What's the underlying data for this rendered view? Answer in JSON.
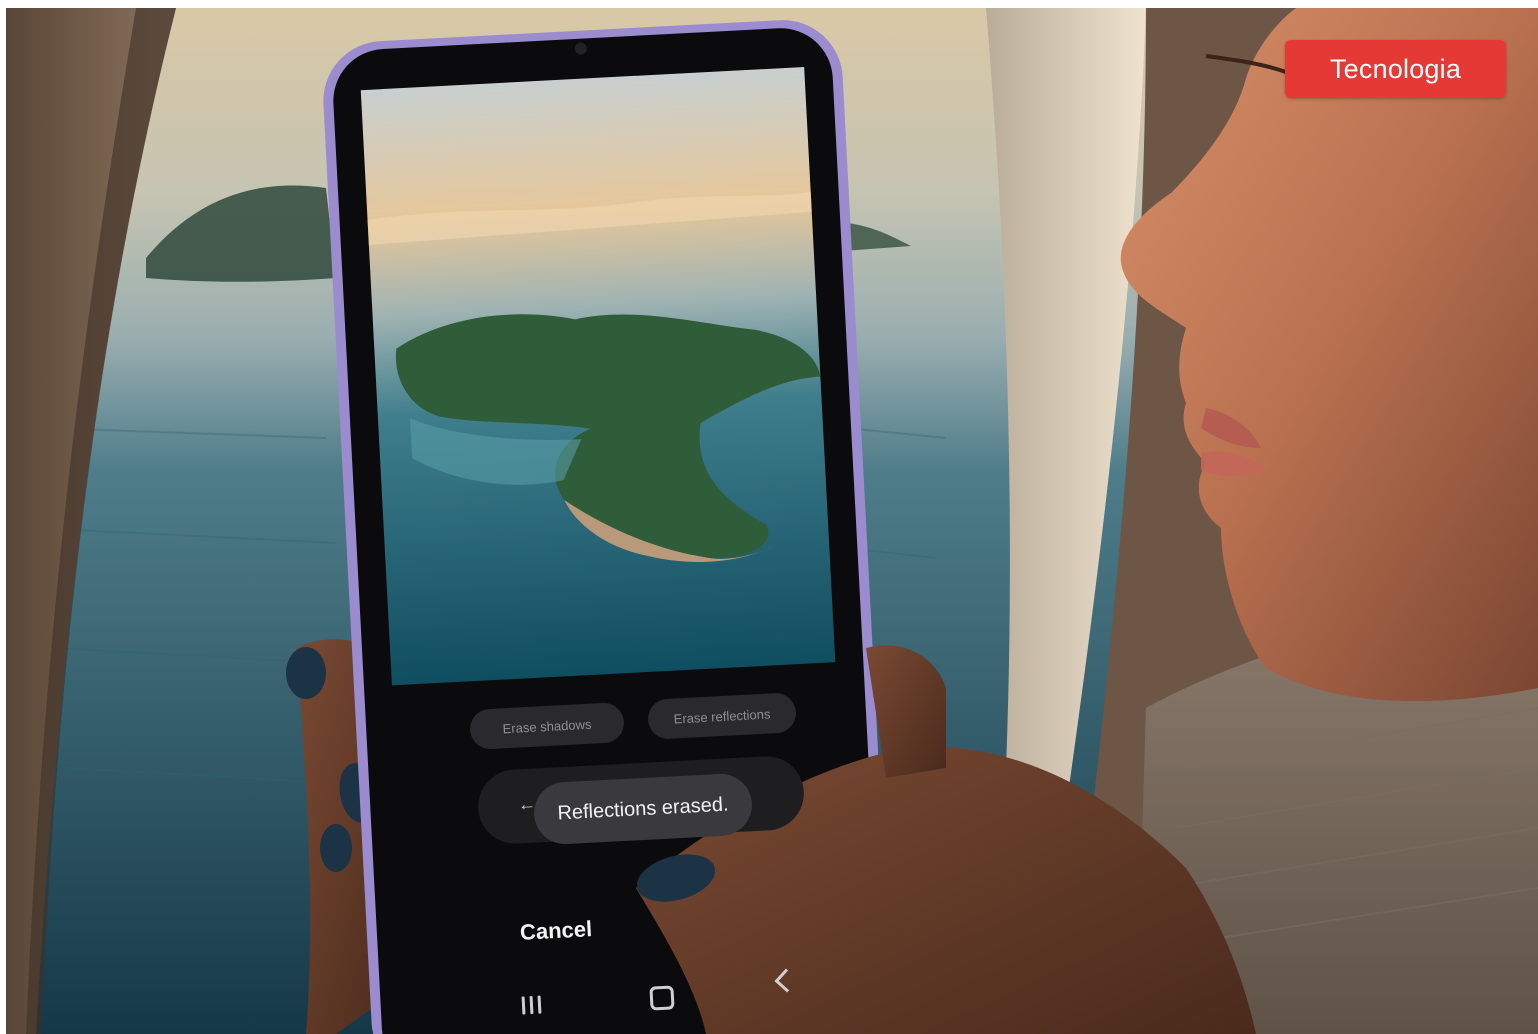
{
  "badge": {
    "label": "Tecnologia",
    "color": "#e53935"
  },
  "phone": {
    "chips": [
      "Erase shadows",
      "Erase reflections"
    ],
    "toast": "Reflections erased.",
    "cancel_label": "Cancel",
    "nav_icons": [
      "recents-icon",
      "home-icon",
      "back-icon"
    ]
  }
}
